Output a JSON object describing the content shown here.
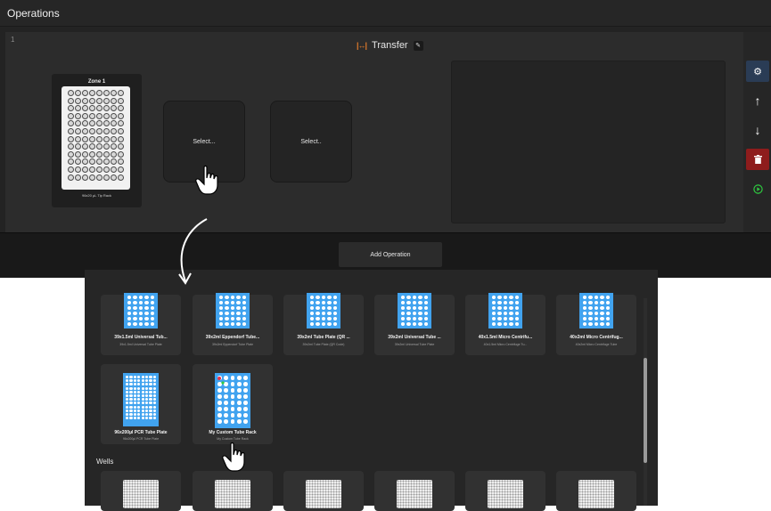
{
  "app": {
    "title": "Operations"
  },
  "operation": {
    "number": "1",
    "name": "Transfer",
    "zone": {
      "label": "Zone 1",
      "rack_label": "96x20 µL Tip Rack"
    },
    "slots": [
      "Select...",
      "Select.."
    ]
  },
  "side_buttons": [
    {
      "icon": "gear-icon",
      "glyph": "⚙",
      "color": "#2a3c55"
    },
    {
      "icon": "arrow-up-icon",
      "glyph": "↑",
      "color": "#262626"
    },
    {
      "icon": "arrow-down-icon",
      "glyph": "↓",
      "color": "#262626"
    },
    {
      "icon": "trash-icon",
      "glyph": "🗑",
      "color": "#8e1c1c"
    },
    {
      "icon": "play-icon",
      "glyph": "▶",
      "color": "#262626"
    }
  ],
  "add_operation_label": "Add Operation",
  "tube_racks_row1": [
    {
      "name": "39x1.5ml Universal Tub...",
      "sub": "39x1.5ml Universal Tube Plate"
    },
    {
      "name": "39x2ml Eppendorf Tube...",
      "sub": "39x2ml Eppendorf Tube Plate"
    },
    {
      "name": "39x2ml Tube Plate (QR ...",
      "sub": "39x2ml Tube Plate (QR Code)"
    },
    {
      "name": "39x2ml Universal Tube ...",
      "sub": "39x2ml Universal Tube Plate"
    },
    {
      "name": "40x1.5ml Micro Centrifu...",
      "sub": "40x1.5ml Micro Centrifuge Tu..."
    },
    {
      "name": "40x2ml Micro Centrifug...",
      "sub": "40x2ml Micro Centrifuge Tube"
    }
  ],
  "tube_racks_row2": [
    {
      "name": "96x200µl PCR Tube Plate",
      "sub": "96x200µl PCR Tube Plate"
    },
    {
      "name": "My Custom Tube Rack",
      "sub": "My Custom Tube Rack"
    }
  ],
  "wells_section": "Wells",
  "colors": {
    "accent_blue": "#41a3ef",
    "delete_red": "#8e1c1c",
    "transfer_orange": "#e07a2a",
    "play_green": "#2ecc40"
  }
}
